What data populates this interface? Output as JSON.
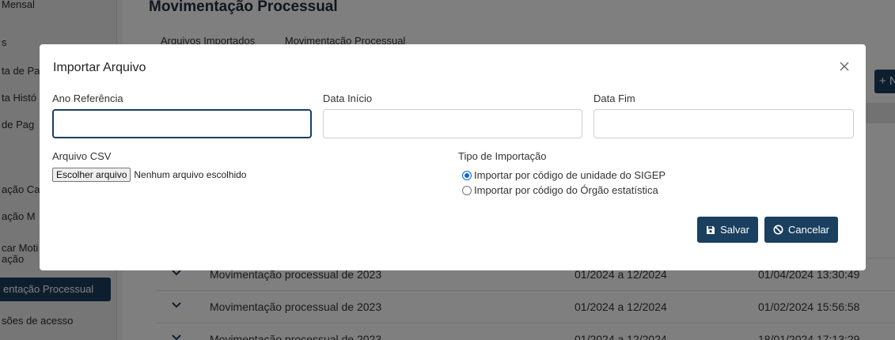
{
  "sidebar": {
    "items": [
      {
        "label": "Mensal"
      },
      {
        "label": "s"
      },
      {
        "label": "ta de Pa"
      },
      {
        "label": "ta Histó"
      },
      {
        "label": "de Pag"
      },
      {
        "label": "ação Ca"
      },
      {
        "label": "ação M"
      },
      {
        "label": "car Moti"
      },
      {
        "label": "ação"
      },
      {
        "label": "entação Processual"
      },
      {
        "label": "sões de acesso"
      }
    ],
    "active_index": 9
  },
  "page": {
    "title": "Movimentação Processual",
    "tabs": [
      {
        "label": "Arquivos Importados"
      },
      {
        "label": "Movimentação Processual"
      }
    ],
    "new_button_label": "+ N"
  },
  "table": {
    "rows": [
      {
        "description": "Movimentação processual de 2023",
        "period": "01/2024 a 12/2024",
        "date": "01/04/2024 13:30:49"
      },
      {
        "description": "Movimentação processual de 2023",
        "period": "01/2024 a 12/2024",
        "date": "01/02/2024 15:56:58"
      },
      {
        "description": "Movimentação processual de 2023",
        "period": "01/2024 a 12/2024",
        "date": "18/01/2024 17:13:29"
      }
    ]
  },
  "modal": {
    "title": "Importar Arquivo",
    "close_icon": "close-icon",
    "fields": {
      "ano_referencia": {
        "label": "Ano Referência",
        "value": ""
      },
      "data_inicio": {
        "label": "Data Início",
        "value": ""
      },
      "data_fim": {
        "label": "Data Fim",
        "value": ""
      }
    },
    "arquivo": {
      "label": "Arquivo CSV",
      "button_label": "Escolher arquivo",
      "status": "Nenhum arquivo escolhido"
    },
    "tipo_importacao": {
      "label": "Tipo de Importação",
      "options": [
        {
          "label": "Importar por código de unidade do SIGEP",
          "checked": true
        },
        {
          "label": "Importar por código do Órgão estatística",
          "checked": false
        }
      ]
    },
    "buttons": {
      "save": "Salvar",
      "cancel": "Cancelar"
    }
  },
  "colors": {
    "primary": "#1a3f5f",
    "radio_accent": "#0a66d6"
  }
}
